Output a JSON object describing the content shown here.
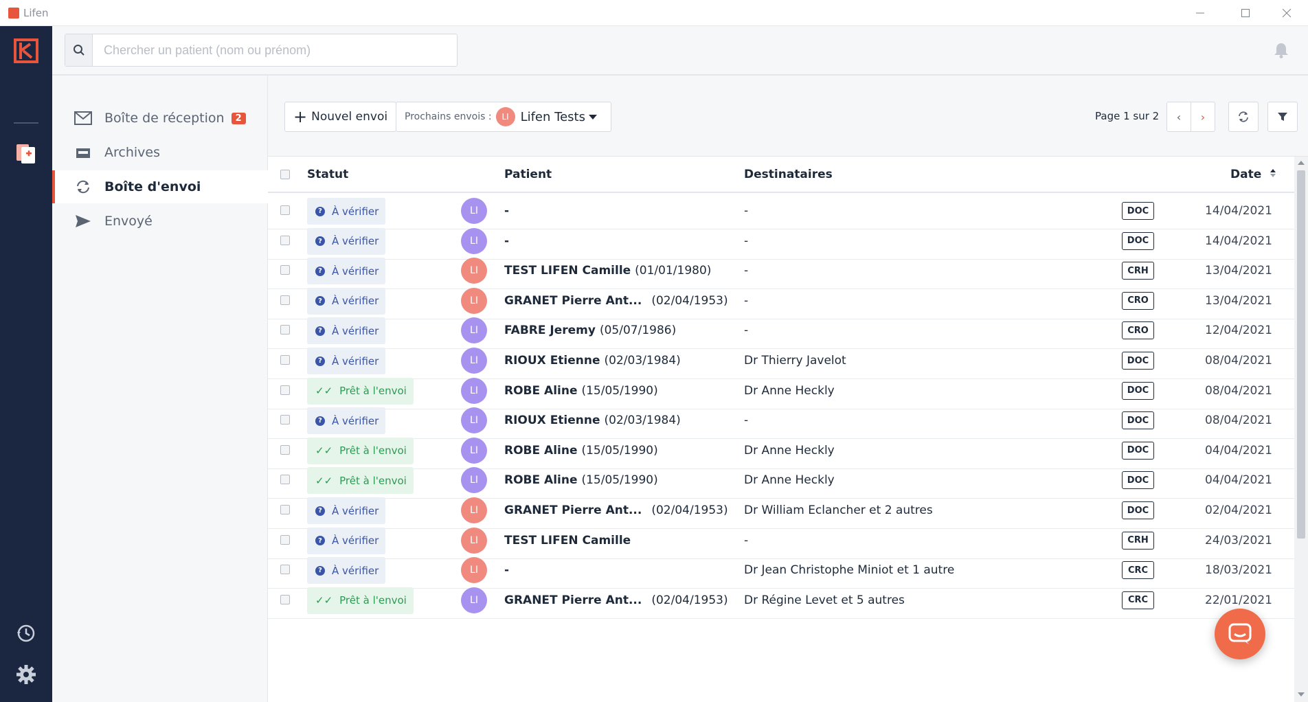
{
  "window": {
    "title": "Lifen"
  },
  "search": {
    "placeholder": "Chercher un patient (nom ou prénom)"
  },
  "sidebar": {
    "items": [
      {
        "label": "Boîte de réception",
        "badge": "2"
      },
      {
        "label": "Archives"
      },
      {
        "label": "Boîte d'envoi"
      },
      {
        "label": "Envoyé"
      }
    ]
  },
  "toolbar": {
    "new_label": "Nouvel envoi",
    "upcoming_label": "Prochains envois :",
    "upcoming_avatar": "LI",
    "upcoming_value": "Lifen Tests",
    "page_info": "Page 1 sur 2"
  },
  "table": {
    "headers": {
      "status": "Statut",
      "patient": "Patient",
      "recipients": "Destinataires",
      "date": "Date"
    },
    "rows": [
      {
        "status": "À vérifier",
        "avatar": "LI",
        "patient": "-",
        "dob": "",
        "dest": "-",
        "doc": "DOC",
        "date": "14/04/2021"
      },
      {
        "status": "À vérifier",
        "avatar": "LI",
        "patient": "-",
        "dob": "",
        "dest": "-",
        "doc": "DOC",
        "date": "14/04/2021"
      },
      {
        "status": "À vérifier",
        "avatar": "LI",
        "patient": "TEST LIFEN Camille",
        "dob": "(01/01/1980)",
        "dest": "-",
        "doc": "CRH",
        "date": "13/04/2021"
      },
      {
        "status": "À vérifier",
        "avatar": "LI",
        "patient": "GRANET Pierre Ant...",
        "dob": "(02/04/1953)",
        "dest": "-",
        "doc": "CRO",
        "date": "13/04/2021"
      },
      {
        "status": "À vérifier",
        "avatar": "LI",
        "patient": "FABRE Jeremy",
        "dob": "(05/07/1986)",
        "dest": "-",
        "doc": "CRO",
        "date": "12/04/2021"
      },
      {
        "status": "À vérifier",
        "avatar": "LI",
        "patient": "RIOUX Etienne",
        "dob": "(02/03/1984)",
        "dest": "Dr Thierry Javelot",
        "doc": "DOC",
        "date": "08/04/2021"
      },
      {
        "status": "Prêt à l'envoi",
        "avatar": "LI",
        "patient": "ROBE Aline",
        "dob": "(15/05/1990)",
        "dest": "Dr Anne Heckly",
        "doc": "DOC",
        "date": "08/04/2021"
      },
      {
        "status": "À vérifier",
        "avatar": "LI",
        "patient": "RIOUX Etienne",
        "dob": "(02/03/1984)",
        "dest": "-",
        "doc": "DOC",
        "date": "08/04/2021"
      },
      {
        "status": "Prêt à l'envoi",
        "avatar": "LI",
        "patient": "ROBE Aline",
        "dob": "(15/05/1990)",
        "dest": "Dr Anne Heckly",
        "doc": "DOC",
        "date": "04/04/2021"
      },
      {
        "status": "Prêt à l'envoi",
        "avatar": "LI",
        "patient": "ROBE Aline",
        "dob": "(15/05/1990)",
        "dest": "Dr Anne Heckly",
        "doc": "DOC",
        "date": "04/04/2021"
      },
      {
        "status": "À vérifier",
        "avatar": "LI",
        "patient": "GRANET Pierre Ant...",
        "dob": "(02/04/1953)",
        "dest": "Dr William Eclancher et 2 autres",
        "doc": "DOC",
        "date": "02/04/2021"
      },
      {
        "status": "À vérifier",
        "avatar": "LI",
        "patient": "TEST LIFEN Camille",
        "dob": "",
        "dest": "-",
        "doc": "CRH",
        "date": "24/03/2021"
      },
      {
        "status": "À vérifier",
        "avatar": "LI",
        "patient": "-",
        "dob": "",
        "dest": "Dr Jean Christophe Miniot et 1 autre",
        "doc": "CRC",
        "date": "18/03/2021"
      },
      {
        "status": "Prêt à l'envoi",
        "avatar": "LI",
        "patient": "GRANET Pierre Ant...",
        "dob": "(02/04/1953)",
        "dest": "Dr Régine Levet et 5 autres",
        "doc": "CRC",
        "date": "22/01/2021"
      }
    ]
  },
  "colors": {
    "brand": "#e8553d",
    "rail": "#1b2640",
    "avatar_purple": "#a892f0",
    "avatar_coral": "#f08a7f",
    "status_verify": "#3a55a8",
    "status_ready": "#2f9a55"
  },
  "icons": {
    "search": "search-icon",
    "bell": "bell-icon",
    "inbox": "mail-icon",
    "archive": "archive-tray-icon",
    "outbox": "sync-icon",
    "sent": "send-icon",
    "refresh": "refresh-icon",
    "filter": "filter-icon",
    "chat": "chat-icon"
  }
}
